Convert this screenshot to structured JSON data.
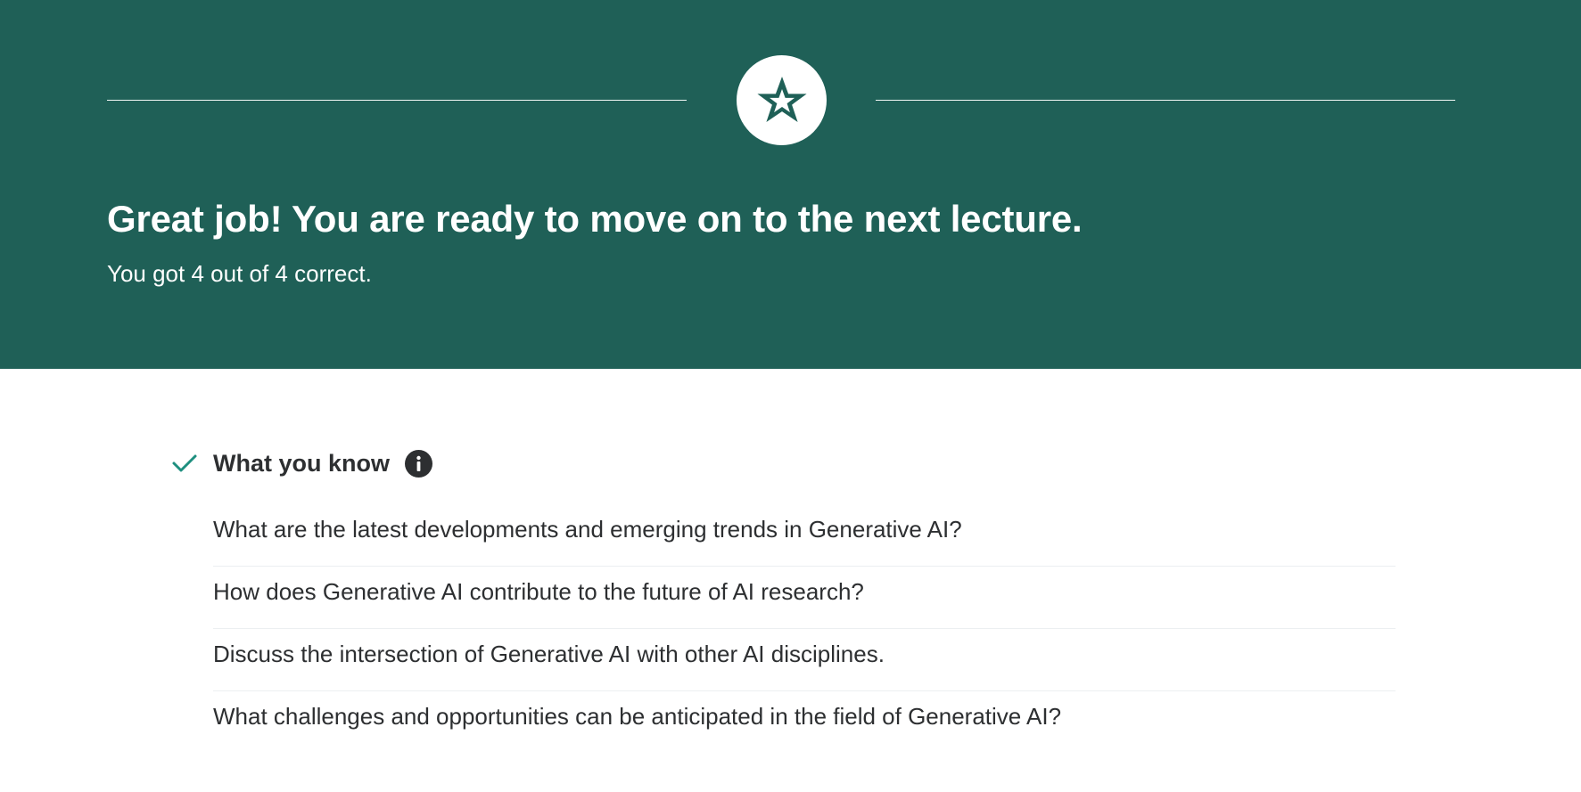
{
  "banner": {
    "icon": "star-icon",
    "headline": "Great job! You are ready to move on to the next lecture.",
    "score_text": "You got 4 out of 4 correct.",
    "colors": {
      "background": "#1f6057",
      "text": "#ffffff"
    }
  },
  "results": {
    "section": {
      "status_icon": "checkmark-icon",
      "status_color": "#1e8f7f",
      "title": "What you know",
      "info_icon": "info-icon"
    },
    "topics": [
      "What are the latest developments and emerging trends in Generative AI?",
      "How does Generative AI contribute to the future of AI research?",
      "Discuss the intersection of Generative AI with other AI disciplines.",
      "What challenges and opportunities can be anticipated in the field of Generative AI?"
    ]
  }
}
